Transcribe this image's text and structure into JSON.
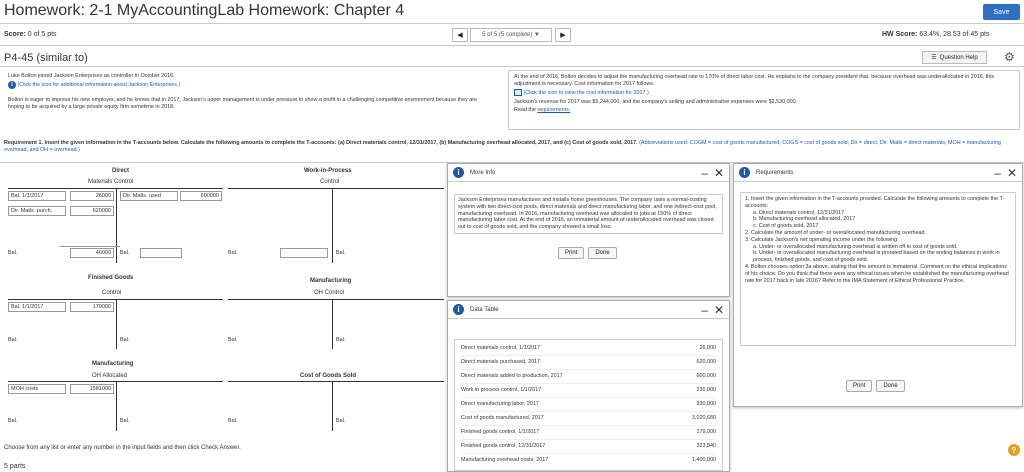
{
  "header": {
    "title": "Homework: 2-1 MyAccountingLab Homework: Chapter 4",
    "save_label": "Save"
  },
  "scorebar": {
    "score_label": "Score:",
    "score_value": "0 of 5 pts",
    "nav_select": "5 of 5 (5 complete)",
    "hw_score_label": "HW Score:",
    "hw_score_value": "63.4%, 28.53 of 45 pts"
  },
  "problem": {
    "title": "P4-45 (similar to)",
    "help_label": "Question Help"
  },
  "intro": {
    "left_p1": "Luke Bolton joined Jackson Enterprises as controller in October 2016.",
    "left_link": "(Click the icon for additional information about Jackson Enterprises.)",
    "left_p2": "Bolton is eager to impress his new employer, and he knows that in 2017, Jackson's upper management is under pressure to show a profit in a challenging competitive environment because they are hoping to be acquired by a large private equity firm sometime in 2018.",
    "right_p1": "At the end of 2016, Bolton decides to adjust the manufacturing overhead rate to 170% of direct labor cost. He explains to the company president that, because overhead was underallocated in 2016, this adjustment is necessary. Cost information for 2017 follows.",
    "right_link": "(Click the icon to view the cost information for 2017.)",
    "right_p2": "Jackson's revenue for 2017 was $5,244,000, and the company's selling and administrative expenses were $2,530,000.",
    "read_the": "Read the",
    "requirements_link": "requirements."
  },
  "requirement": {
    "text": "Requirement 1. Insert the given information in the T-accounts below. Calculate the following amounts to complete the T-accounts: (a) Direct materials control, 12/31/2017, (b) Manufacturing overhead allocated, 2017, and (c) Cost of goods sold, 2017.",
    "abbrev": "(Abbreviations used: COGM = cost of goods manufactured, COGS = cost of goods sold, Dir = direct, Dir. Matls = direct materials, MOH = manufacturing overhead, and OH = overhead.)"
  },
  "taccounts": {
    "direct": {
      "title": "Direct",
      "subtitle": "Materials Control",
      "r1_label": "Bal. 1/1/2017",
      "r1_left": "26000",
      "r1_right_label": "Dir. Matls. used",
      "r1_right": "600000",
      "r2_label": "Dir. Matls. purch.",
      "r2_left": "620000",
      "bal_label": "Bal.",
      "bal_left": "46000",
      "bal_right_label": "Bal."
    },
    "wip": {
      "title": "Work-in-Process",
      "subtitle": "Control",
      "bal_label": "Bal.",
      "bal_right_label": "Bal."
    },
    "fg": {
      "title": "Finished Goods",
      "subtitle": "Control",
      "r1_label": "Bal. 1/1/2017",
      "r1_left": "179000",
      "bal_label": "Bal.",
      "bal_right_label": "Bal."
    },
    "moh": {
      "title": "Manufacturing",
      "subtitle": "OH Control",
      "bal_label": "Bal.",
      "bal_right_label": "Bal."
    },
    "moha": {
      "title": "Manufacturing",
      "subtitle": "OH Allocated",
      "r1_label": "MOH costs",
      "r1_left": "1581000",
      "bal_label": "Bal.",
      "bal_right_label": "Bal."
    },
    "cogs": {
      "title": "Cost of Goods Sold",
      "bal_label": "Bal.",
      "bal_right_label": "Bal."
    }
  },
  "more_info": {
    "title": "More Info",
    "text": "Jackson Enterprises manufactures and installs home greenhouses. The company uses a normal-costing system with two direct-cost pools, direct materials and direct manufacturing labor, and one indirect-cost pool, manufacturing overhead. In 2016, manufacturing overhead was allocated to jobs at 150% of direct manufacturing labor cost. At the end of 2016, an immaterial amount of underallocated overhead was closed out to cost of goods sold, and the company showed a small loss.",
    "print": "Print",
    "done": "Done"
  },
  "requirements_popup": {
    "title": "Requirements",
    "items": [
      "1. Insert the given information in the T-accounts provided. Calculate the following amounts to complete the T-accounts:",
      "a. Direct materials control, 12/31/2017",
      "b. Manufacturing overhead allocated, 2017",
      "c. Cost of goods sold, 2017",
      "2. Calculate the amount of under- or overallocated manufacturing overhead.",
      "3. Calculate Jackson's net operating income under the following:",
      "a. Under- or overallocated manufacturing overhead is written off to cost of goods sold.",
      "b. Under- or overallocated manufacturing overhead is prorated based on the ending balances in work in process, finished goods, and cost of goods sold.",
      "4. Bolton chooses option 3a above, stating that the amount is immaterial. Comment on the ethical implications of his choice. Do you think that there were any ethical issues when he established the manufacturing overhead rate for 2017 back in late 2016? Refer to the IMA Statement of Ethical Professional Practice."
    ],
    "print": "Print",
    "done": "Done"
  },
  "data_table": {
    "title": "Data Table",
    "rows": [
      {
        "label": "Direct materials control, 1/1/2017",
        "value": "26,000"
      },
      {
        "label": "Direct materials purchased, 2017",
        "value": "620,000"
      },
      {
        "label": "Direct materials added to production, 2017",
        "value": "600,000"
      },
      {
        "label": "Work in process control, 1/1/2017",
        "value": "230,000"
      },
      {
        "label": "Direct manufacturing labor, 2017",
        "value": "930,000"
      },
      {
        "label": "Cost of goods manufactured, 2017",
        "value": "3,020,680"
      },
      {
        "label": "Finished goods control, 1/1/2017",
        "value": "179,000"
      },
      {
        "label": "Finished goods control, 12/31/2017",
        "value": "323,840"
      },
      {
        "label": "Manufacturing overhead costs, 2017",
        "value": "1,400,000"
      }
    ]
  },
  "footer": {
    "instruction": "Choose from any list or enter any number in the input fields and then click Check Answer.",
    "parts": "5 parts"
  }
}
